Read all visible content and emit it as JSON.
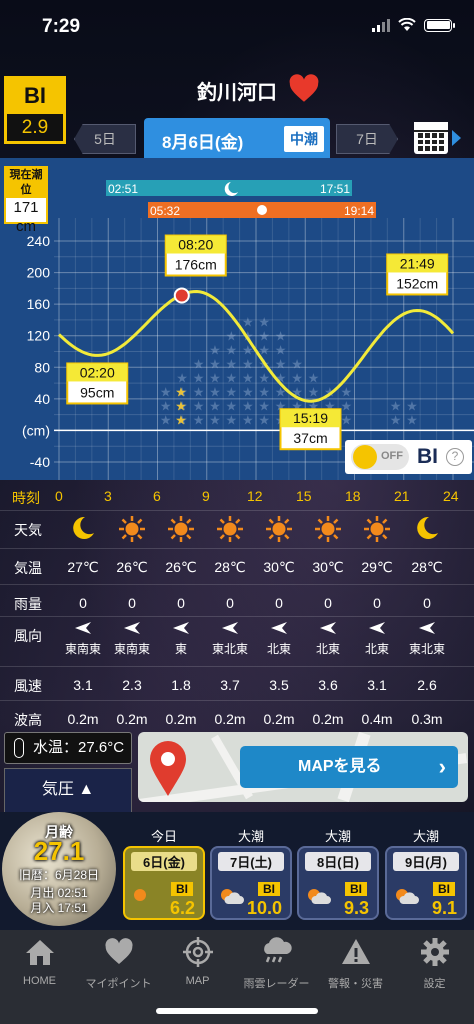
{
  "status": {
    "time": "7:29"
  },
  "header": {
    "bi_label": "BI",
    "bi_value": "2.9",
    "location": "釣川河口"
  },
  "date_nav": {
    "prev": "5日",
    "current": "8月6日(金)",
    "tide": "中潮",
    "next": "7日"
  },
  "current_level": {
    "label": "現在潮位",
    "value": "171",
    "unit": "cm"
  },
  "moon_bar": {
    "start": "02:51",
    "end": "17:51"
  },
  "sun_bar": {
    "start": "05:32",
    "end": "19:14"
  },
  "chart_data": {
    "type": "line",
    "y_ticks": [
      "240",
      "200",
      "160",
      "120",
      "80",
      "40",
      "(cm)",
      "-40"
    ],
    "x_label": "時刻",
    "x_ticks": [
      "0",
      "3",
      "6",
      "9",
      "12",
      "15",
      "18",
      "21",
      "24"
    ],
    "ylim": [
      -60,
      270
    ],
    "xlim": [
      0,
      24
    ],
    "extremes": [
      {
        "time": "02:20",
        "level": "95cm",
        "t": 2.33,
        "v": 95
      },
      {
        "time": "08:20",
        "level": "176cm",
        "t": 8.33,
        "v": 176
      },
      {
        "time": "15:19",
        "level": "37cm",
        "t": 15.32,
        "v": 37
      },
      {
        "time": "21:49",
        "level": "152cm",
        "t": 21.82,
        "v": 152
      }
    ],
    "current_point": {
      "t": 7.48,
      "v": 171
    }
  },
  "bi_toggle": {
    "state": "OFF",
    "label": "BI",
    "help": "?"
  },
  "weather_table": {
    "labels": {
      "weather": "天気",
      "temp": "気温",
      "rain": "雨量",
      "wind_dir": "風向",
      "wind_speed": "風速",
      "wave": "波高"
    },
    "cols": [
      {
        "weather": "moon",
        "temp": "27℃",
        "rain": "0",
        "dir": "東南東",
        "speed": "3.1",
        "wave": "0.2m"
      },
      {
        "weather": "sun",
        "temp": "26℃",
        "rain": "0",
        "dir": "東南東",
        "speed": "2.3",
        "wave": "0.2m"
      },
      {
        "weather": "sun",
        "temp": "26℃",
        "rain": "0",
        "dir": "東",
        "speed": "1.8",
        "wave": "0.2m"
      },
      {
        "weather": "sun",
        "temp": "28℃",
        "rain": "0",
        "dir": "東北東",
        "speed": "3.7",
        "wave": "0.2m"
      },
      {
        "weather": "sun",
        "temp": "30℃",
        "rain": "0",
        "dir": "北東",
        "speed": "3.5",
        "wave": "0.2m"
      },
      {
        "weather": "sun",
        "temp": "30℃",
        "rain": "0",
        "dir": "北東",
        "speed": "3.6",
        "wave": "0.2m"
      },
      {
        "weather": "sun",
        "temp": "29℃",
        "rain": "0",
        "dir": "北東",
        "speed": "3.1",
        "wave": "0.4m"
      },
      {
        "weather": "moon",
        "temp": "28℃",
        "rain": "0",
        "dir": "東北東",
        "speed": "2.6",
        "wave": "0.3m"
      }
    ]
  },
  "water_temp": "水温：27.6°C",
  "pressure": "気圧",
  "map_button": "MAPを見る",
  "moon_info": {
    "title": "月齢",
    "age": "27.1",
    "old_cal": "旧暦：6月28日",
    "moonrise": "月出 02:51",
    "moonset": "月入 17:51"
  },
  "days": [
    {
      "label": "今日",
      "date": "6日(金)",
      "bi_label": "BI",
      "bi": "6.2"
    },
    {
      "label": "大潮",
      "date": "7日(土)",
      "bi_label": "BI",
      "bi": "10.0"
    },
    {
      "label": "大潮",
      "date": "8日(日)",
      "bi_label": "BI",
      "bi": "9.3"
    },
    {
      "label": "大潮",
      "date": "9日(月)",
      "bi_label": "BI",
      "bi": "9.1"
    }
  ],
  "tabs": [
    "HOME",
    "マイポイント",
    "MAP",
    "雨雲レーダー",
    "警報・災害",
    "設定"
  ]
}
